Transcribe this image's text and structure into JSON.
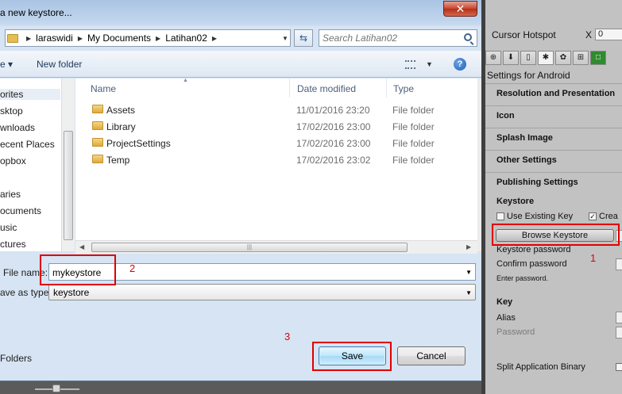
{
  "dialog": {
    "title": "a new keystore...",
    "close_glyph": "✕",
    "breadcrumb": [
      "laraswidi",
      "My Documents",
      "Latihan02"
    ],
    "search_placeholder": "Search Latihan02",
    "toolbar": {
      "organize": "e ▾",
      "new_folder": "New folder"
    },
    "nav_items": [
      "orites",
      "sktop",
      "wnloads",
      "ecent Places",
      "opbox",
      "aries",
      "ocuments",
      "usic",
      "ctures"
    ],
    "columns": {
      "name": "Name",
      "date": "Date modified",
      "type": "Type"
    },
    "files": [
      {
        "name": "Assets",
        "date": "11/01/2016 23:20",
        "type": "File folder"
      },
      {
        "name": "Library",
        "date": "17/02/2016 23:00",
        "type": "File folder"
      },
      {
        "name": "ProjectSettings",
        "date": "17/02/2016 23:00",
        "type": "File folder"
      },
      {
        "name": "Temp",
        "date": "17/02/2016 23:02",
        "type": "File folder"
      }
    ],
    "file_name_label": "File name:",
    "file_name_value": "mykeystore",
    "save_type_label": "ave as type:",
    "save_type_value": "keystore",
    "folders_label": "Folders",
    "save_label": "Save",
    "cancel_label": "Cancel"
  },
  "annotations": {
    "one": "1",
    "two": "2",
    "three": "3"
  },
  "inspector": {
    "cursor_hotspot_label": "Cursor Hotspot",
    "x_label": "X",
    "x_value": "0",
    "platform_title": "Settings for Android",
    "sections": [
      "Resolution and Presentation",
      "Icon",
      "Splash Image",
      "Other Settings"
    ],
    "publishing": "Publishing Settings",
    "keystore_heading": "Keystore",
    "use_existing": "Use Existing Key",
    "create_new": "Crea",
    "browse": "Browse Keystore",
    "keystore_password": "Keystore password",
    "confirm_password": "Confirm password",
    "enter_password": "Enter password.",
    "key_heading": "Key",
    "alias": "Alias",
    "password": "Password",
    "split_binary": "Split Application Binary"
  },
  "colors": {
    "highlight": "#e00000",
    "dialog_chrome": "#c4d8ee",
    "inspector_bg": "#c2c2c2"
  }
}
